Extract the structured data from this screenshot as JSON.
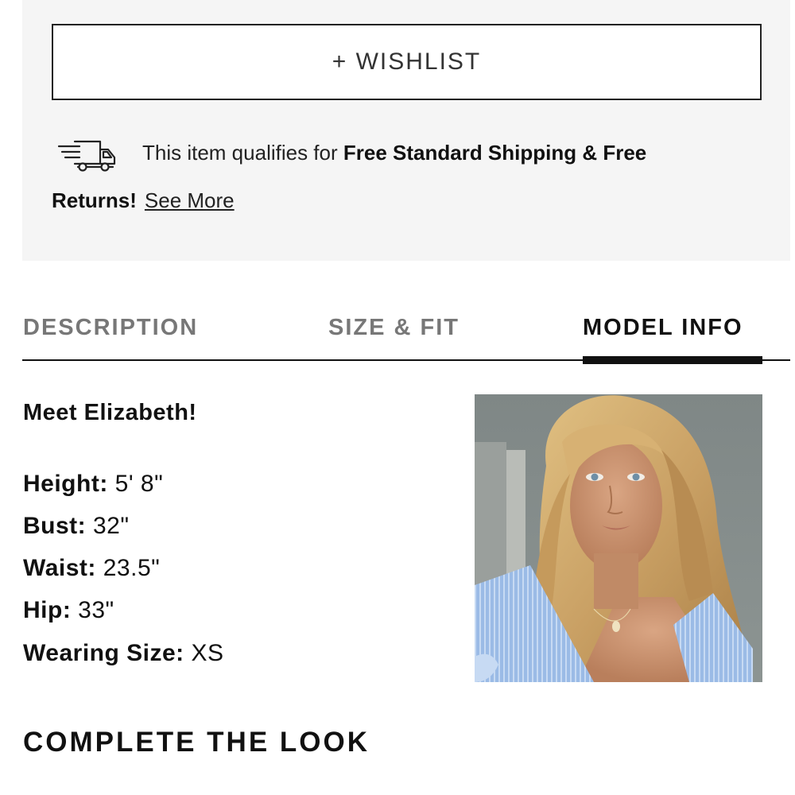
{
  "wishlist": {
    "label": "+ WISHLIST"
  },
  "shipping": {
    "icon": "delivery-truck-icon",
    "prefix": "This item qualifies for ",
    "bold_line1": "Free Standard Shipping & Free",
    "bold_line2": "Returns!",
    "see_more": "See More"
  },
  "tabs": [
    {
      "label": "DESCRIPTION",
      "active": false
    },
    {
      "label": "SIZE & FIT",
      "active": false
    },
    {
      "label": "MODEL INFO",
      "active": true
    }
  ],
  "model": {
    "greeting": "Meet Elizabeth!",
    "stats": [
      {
        "label": "Height:",
        "value": "5' 8\""
      },
      {
        "label": "Bust:",
        "value": "32\""
      },
      {
        "label": "Waist:",
        "value": "23.5\""
      },
      {
        "label": "Hip:",
        "value": "33\""
      },
      {
        "label": "Wearing Size:",
        "value": "XS"
      }
    ]
  },
  "complete_the_look": {
    "title": "COMPLETE THE LOOK"
  }
}
